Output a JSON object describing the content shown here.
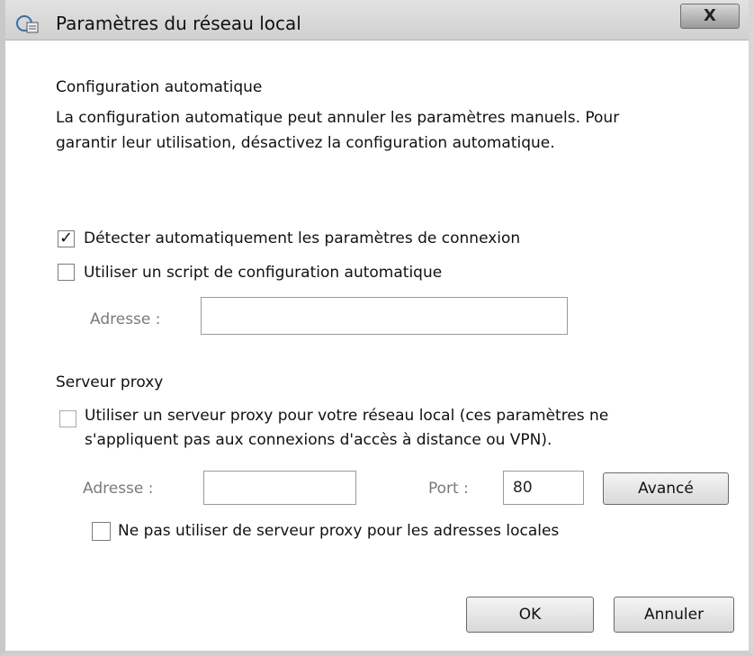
{
  "window": {
    "title": "Paramètres du réseau local",
    "close_label": "X"
  },
  "auto_config": {
    "heading": "Configuration automatique",
    "description_line1": "La configuration automatique peut annuler les paramètres manuels. Pour",
    "description_line2": "garantir leur utilisation, désactivez la configuration automatique.",
    "detect_label": "Détecter automatiquement les paramètres de connexion",
    "detect_checked": true,
    "script_label": "Utiliser un script de configuration automatique",
    "script_checked": false,
    "address_label": "Adresse :",
    "address_value": ""
  },
  "proxy": {
    "heading": "Serveur proxy",
    "use_proxy_line1": "Utiliser un serveur proxy pour votre réseau local (ces paramètres ne",
    "use_proxy_line2": "s'appliquent pas aux connexions d'accès à distance ou VPN).",
    "use_proxy_checked": false,
    "address_label": "Adresse :",
    "address_value": "",
    "port_label": "Port :",
    "port_value": "80",
    "advanced_label": "Avancé",
    "bypass_label": "Ne pas utiliser de serveur proxy pour les adresses locales",
    "bypass_checked": false
  },
  "footer": {
    "ok_label": "OK",
    "cancel_label": "Annuler"
  }
}
